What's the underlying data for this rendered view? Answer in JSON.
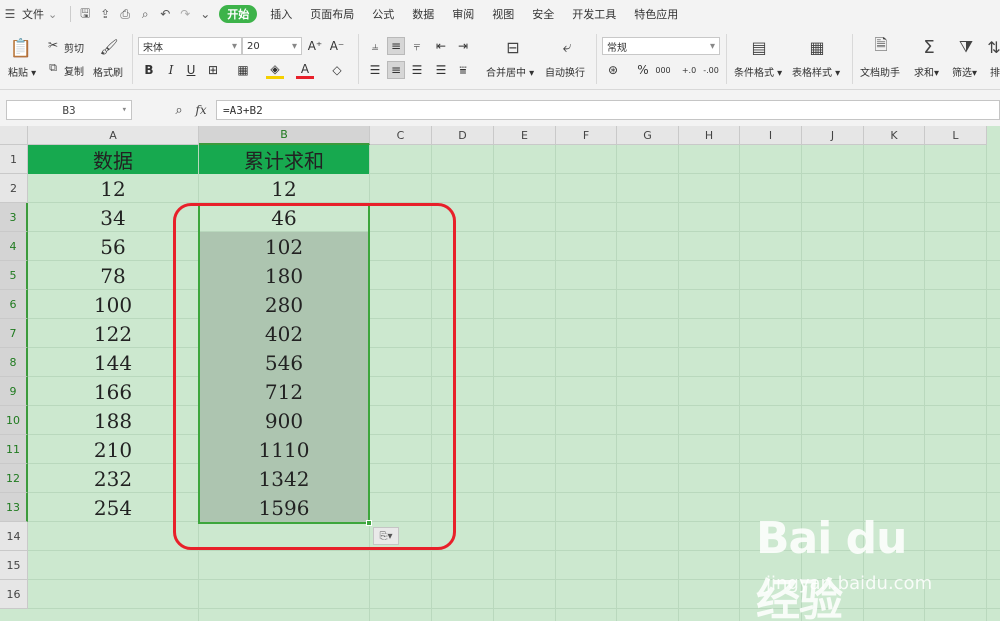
{
  "menubar": {
    "file_label": "文件",
    "tabs": [
      {
        "label": "开始",
        "active": true
      },
      {
        "label": "插入"
      },
      {
        "label": "页面布局"
      },
      {
        "label": "公式"
      },
      {
        "label": "数据"
      },
      {
        "label": "审阅"
      },
      {
        "label": "视图"
      },
      {
        "label": "安全"
      },
      {
        "label": "开发工具"
      },
      {
        "label": "特色应用"
      }
    ]
  },
  "ribbon": {
    "paste": "粘贴",
    "cut": "剪切",
    "copy": "复制",
    "format_painter": "格式刷",
    "font_name": "宋体",
    "font_size": "20",
    "merge_center": "合并居中",
    "wrap_text": "自动换行",
    "number_format": "常规",
    "percent": "%",
    "thousands": "000",
    "dec_inc": "+.0",
    "dec_dec": "-.00",
    "conditional_format": "条件格式",
    "table_style": "表格样式",
    "doc_assistant": "文档助手",
    "sum": "求和",
    "filter": "筛选",
    "sort": "排"
  },
  "formula_bar": {
    "cell_ref": "B3",
    "fx": "fx",
    "formula": "=A3+B2"
  },
  "columns": [
    "A",
    "B",
    "C",
    "D",
    "E",
    "F",
    "G",
    "H",
    "I",
    "J",
    "K",
    "L"
  ],
  "rows": [
    "1",
    "2",
    "3",
    "4",
    "5",
    "6",
    "7",
    "8",
    "9",
    "10",
    "11",
    "12",
    "13",
    "14",
    "15",
    "16"
  ],
  "sheet": {
    "header_a": "数据",
    "header_b": "累计求和",
    "col_a": [
      "12",
      "34",
      "56",
      "78",
      "100",
      "122",
      "144",
      "166",
      "188",
      "210",
      "232",
      "254"
    ],
    "col_b": [
      "12",
      "46",
      "102",
      "180",
      "280",
      "402",
      "546",
      "712",
      "900",
      "1110",
      "1342",
      "1596"
    ]
  },
  "watermark": {
    "brand": "Bai du 经验",
    "url": "jingyan.baidu.com"
  },
  "colors": {
    "sheet_bg": "#cce8cf",
    "header_green": "#17a94f",
    "selection_fill": "#adc5b0",
    "highlight_red": "#e8202a",
    "tab_active": "#3db34a"
  }
}
